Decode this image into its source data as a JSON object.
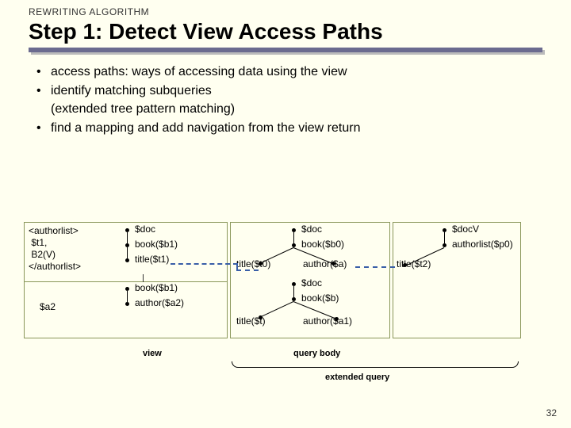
{
  "header": {
    "subtitle": "REWRITING ALGORITHM",
    "title": "Step 1: Detect View Access Paths"
  },
  "bullets": {
    "b1": "access paths: ways of accessing data using the view",
    "b2": "identify matching subqueries",
    "b2_cont": "(extended tree pattern matching)",
    "b3": "find a mapping and add navigation from the view return"
  },
  "view_src": {
    "l1": "<authorlist>",
    "l2": " $t1,",
    "l3": " B2(V)",
    "l4": "</authorlist>"
  },
  "col1": {
    "n1": "$doc",
    "n2": "book($b1)",
    "n3": "title($t1)",
    "n4": "book($b1)",
    "n5": "author($a2)"
  },
  "col2": {
    "n1": "$doc",
    "n2": "book($b0)",
    "n3": "title($t0)",
    "n4": "author($a)",
    "n5": "$doc",
    "n6": "book($b)",
    "n7": "title($t)",
    "n8": "author($a1)"
  },
  "col3": {
    "n1": "$docV",
    "n2": "authorlist($p0)",
    "n3": "title($t2)"
  },
  "a2": "$a2",
  "captions": {
    "view": "view",
    "qbody": "query body",
    "ext": "extended query"
  },
  "page": "32"
}
